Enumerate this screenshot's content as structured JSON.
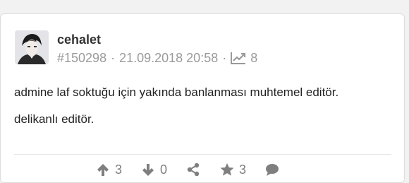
{
  "entry": {
    "author": "cehalet",
    "id_label": "#150298",
    "datetime": "21.09.2018 20:58",
    "separator": "·",
    "views": "8",
    "paragraphs": [
      "admine laf soktuğu için yakında banlanması muhtemel editör.",
      "delikanlı editör."
    ]
  },
  "actions": {
    "upvotes": "3",
    "downvotes": "0",
    "favorites": "3"
  },
  "icons": {
    "avatar": "avatar-image",
    "views": "trend-chart-icon",
    "upvote": "arrow-up-icon",
    "downvote": "arrow-down-icon",
    "share": "share-icon",
    "favorite": "star-icon",
    "comment": "comment-icon"
  },
  "colors": {
    "text": "#222222",
    "muted": "#9a9a9a",
    "icon": "#7f7f7f"
  }
}
